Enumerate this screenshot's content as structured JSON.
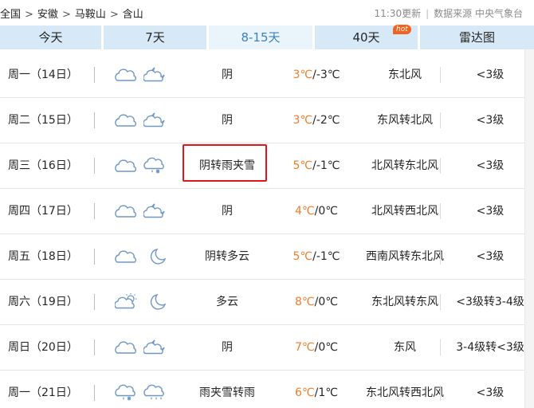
{
  "breadcrumb": {
    "items": [
      "全国",
      "安徽",
      "马鞍山",
      "含山"
    ],
    "separator": ">"
  },
  "update": {
    "time": "11:30更新",
    "source": "数据来源 中央气象台"
  },
  "tabs": [
    {
      "label": "今天",
      "active": false
    },
    {
      "label": "7天",
      "active": false
    },
    {
      "label": "8-15天",
      "active": true
    },
    {
      "label": "40天",
      "badge": "hot",
      "active": false
    },
    {
      "label": "雷达图",
      "active": false
    }
  ],
  "colors": {
    "accent": "#3d7fc2",
    "tab_bg": "#d7e9f7",
    "high_temp": "#f07d2a",
    "highlight": "#e0161c",
    "icon": "#6f97c6"
  },
  "rows": [
    {
      "date": "周一（14日）",
      "icons": [
        "cloudy-icon",
        "cloudy-night-icon"
      ],
      "weather": "阴",
      "high": "3℃",
      "low": "/-3℃",
      "wind": "东北风",
      "level": "<3级"
    },
    {
      "date": "周二（15日）",
      "icons": [
        "cloudy-icon",
        "cloudy-night-icon"
      ],
      "weather": "阴",
      "high": "3℃",
      "low": "/-2℃",
      "wind": "东风转北风",
      "level": "<3级"
    },
    {
      "date": "周三（16日）",
      "icons": [
        "cloudy-icon",
        "sleet-icon"
      ],
      "weather": "阴转雨夹雪",
      "high": "5℃",
      "low": "/-1℃",
      "wind": "北风转东北风",
      "level": "<3级"
    },
    {
      "date": "周四（17日）",
      "icons": [
        "cloudy-icon",
        "cloudy-night-icon"
      ],
      "weather": "阴",
      "high": "4℃",
      "low": "/0℃",
      "wind": "北风转西北风",
      "level": "<3级"
    },
    {
      "date": "周五（18日）",
      "icons": [
        "cloudy-icon",
        "moon-icon"
      ],
      "weather": "阴转多云",
      "high": "5℃",
      "low": "/-1℃",
      "wind": "西南风转东北风",
      "level": "<3级"
    },
    {
      "date": "周六（19日）",
      "icons": [
        "partly-cloudy-icon",
        "moon-icon"
      ],
      "weather": "多云",
      "high": "8℃",
      "low": "/0℃",
      "wind": "东北风转东风",
      "level": "<3级转3-4级"
    },
    {
      "date": "周日（20日）",
      "icons": [
        "cloudy-icon",
        "cloudy-night-icon"
      ],
      "weather": "阴",
      "high": "7℃",
      "low": "/0℃",
      "wind": "东风",
      "level": "3-4级转<3级"
    },
    {
      "date": "周一（21日）",
      "icons": [
        "sleet-icon",
        "rain-icon"
      ],
      "weather": "雨夹雪转雨",
      "high": "6℃",
      "low": "/1℃",
      "wind": "东北风转西北风",
      "level": "<3级"
    }
  ]
}
